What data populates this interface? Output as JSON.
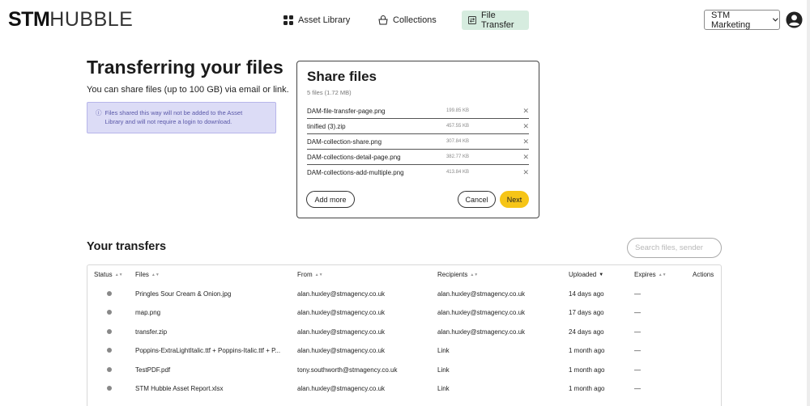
{
  "header": {
    "logo_bold": "STM",
    "logo_light": "HUBBLE",
    "nav": [
      {
        "label": "Asset Library",
        "icon": "grid-icon"
      },
      {
        "label": "Collections",
        "icon": "basket-icon"
      },
      {
        "label": "File Transfer",
        "icon": "transfer-icon",
        "active": true
      }
    ],
    "org_select": "STM Marketing",
    "active_color": "#d6ecdf"
  },
  "intro": {
    "title": "Transferring your files",
    "subtitle": "You can share files (up to 100 GB) via email or link.",
    "info_line1": "Files shared this way will not be added to the Asset",
    "info_line2": "Library and will not require a login to download."
  },
  "share": {
    "title": "Share files",
    "count": "5 files (1.72 MB)",
    "files": [
      {
        "name": "DAM-file-transfer-page.png",
        "size": "199.85 KB"
      },
      {
        "name": "tinified (3).zip",
        "size": "457.55 KB"
      },
      {
        "name": "DAM-collection-share.png",
        "size": "307.84 KB"
      },
      {
        "name": "DAM-collections-detail-page.png",
        "size": "382.77 KB"
      },
      {
        "name": "DAM-collections-add-multiple.png",
        "size": "413.84 KB"
      }
    ],
    "add_more": "Add more",
    "cancel": "Cancel",
    "next": "Next",
    "accent": "#f6c517"
  },
  "transfers": {
    "title": "Your transfers",
    "search_placeholder": "Search files, sender",
    "columns": [
      "Status",
      "Files",
      "From",
      "Recipients",
      "Uploaded",
      "Expires",
      "Actions"
    ],
    "rows": [
      {
        "file": "Pringles Sour Cream & Onion.jpg",
        "from": "alan.huxley@stmagency.co.uk",
        "recipients": "alan.huxley@stmagency.co.uk",
        "uploaded": "14 days ago",
        "expires": "—"
      },
      {
        "file": "map.png",
        "from": "alan.huxley@stmagency.co.uk",
        "recipients": "alan.huxley@stmagency.co.uk",
        "uploaded": "17 days ago",
        "expires": "—"
      },
      {
        "file": "transfer.zip",
        "from": "alan.huxley@stmagency.co.uk",
        "recipients": "alan.huxley@stmagency.co.uk",
        "uploaded": "24 days ago",
        "expires": "—"
      },
      {
        "file": "Poppins-ExtraLightItalic.ttf + Poppins-Italic.ttf + P...",
        "from": "alan.huxley@stmagency.co.uk",
        "recipients": "Link",
        "uploaded": "1 month ago",
        "expires": "—"
      },
      {
        "file": "TestPDF.pdf",
        "from": "tony.southworth@stmagency.co.uk",
        "recipients": "Link",
        "uploaded": "1 month ago",
        "expires": "—"
      },
      {
        "file": "STM Hubble Asset Report.xlsx",
        "from": "alan.huxley@stmagency.co.uk",
        "recipients": "Link",
        "uploaded": "1 month ago",
        "expires": "—"
      }
    ]
  }
}
